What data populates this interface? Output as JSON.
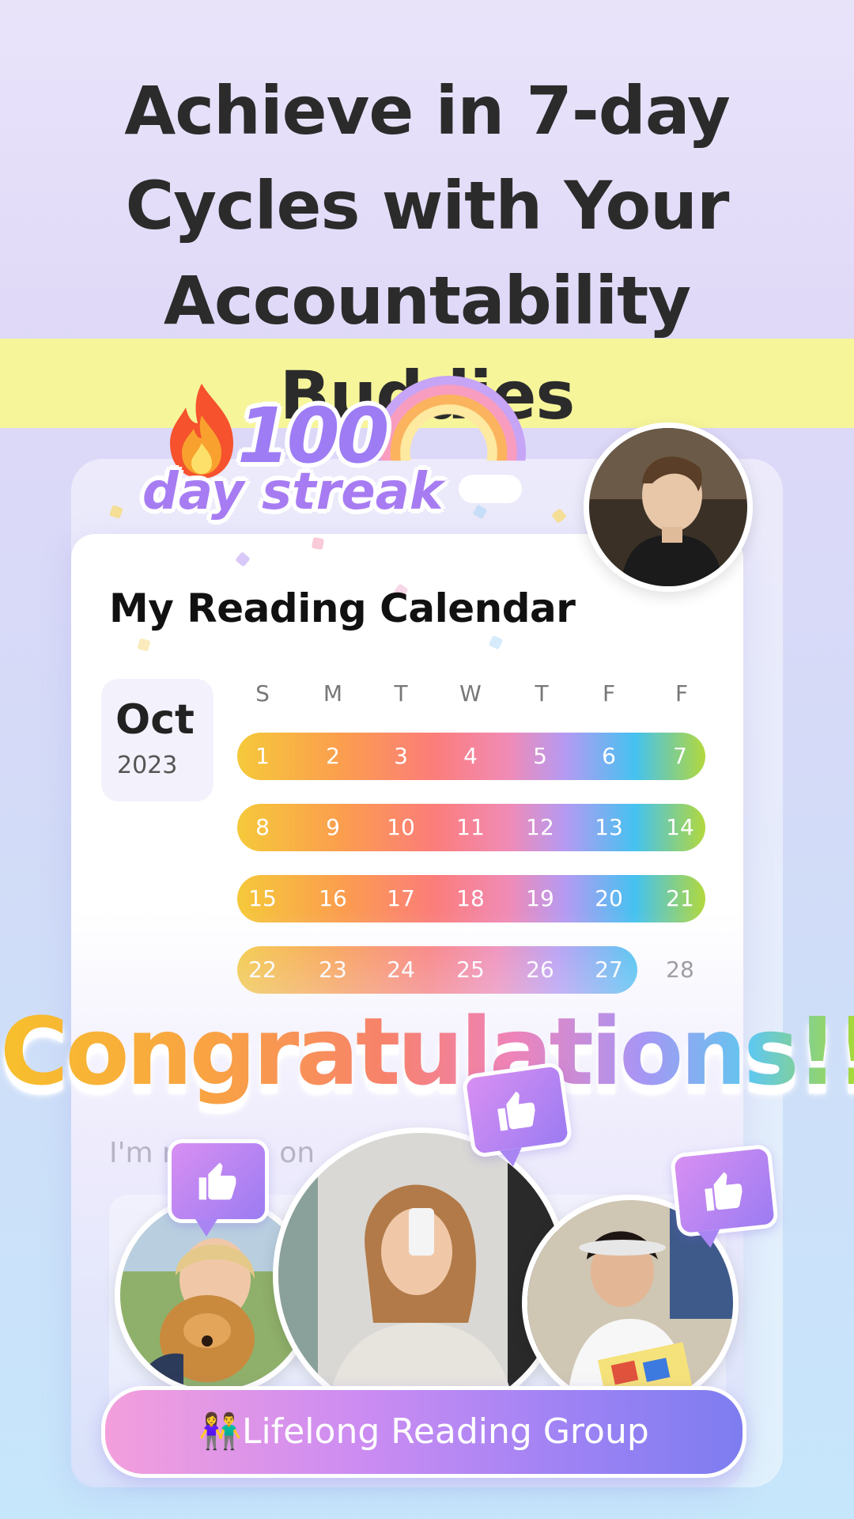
{
  "headline": {
    "line1": "Achieve in 7-day",
    "line2": "Cycles with Your",
    "line3": "Accountability Buddies"
  },
  "streak": {
    "number": "100",
    "label": "day streak"
  },
  "calendar": {
    "title": "My Reading Calendar",
    "month": "Oct",
    "year": "2023",
    "weekdays": [
      "S",
      "M",
      "T",
      "W",
      "T",
      "F",
      "F"
    ],
    "weeks": [
      [
        "1",
        "2",
        "3",
        "4",
        "5",
        "6",
        "7"
      ],
      [
        "8",
        "9",
        "10",
        "11",
        "12",
        "13",
        "14"
      ],
      [
        "15",
        "16",
        "17",
        "18",
        "19",
        "20",
        "21"
      ],
      [
        "22",
        "23",
        "24",
        "25",
        "26",
        "27",
        "28"
      ]
    ]
  },
  "congrats": "Congratulations!!",
  "input_hint": "I'm reading on",
  "group": {
    "emoji": "👫",
    "name": "Lifelong Reading Group"
  },
  "colors": {
    "headline_text": "#2b2b2b",
    "highlight": "#f6f59a",
    "accent_purple": "#9d7cf4",
    "pill_start": "#f39fdc",
    "pill_end": "#7d7df0"
  }
}
